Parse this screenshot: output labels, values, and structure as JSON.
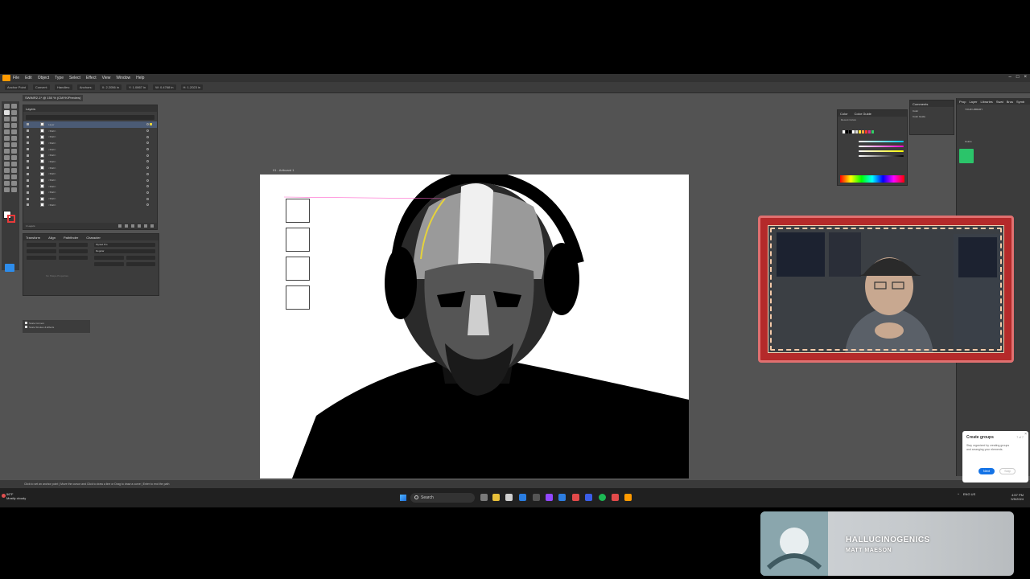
{
  "window": {
    "menus": [
      "File",
      "Edit",
      "Object",
      "Type",
      "Select",
      "Effect",
      "View",
      "Window",
      "Help"
    ],
    "doc_tab": "SWIMR2-1* @ 150 % (CMYK/Preview)",
    "control_bar": [
      "Anchor Point",
      "Convert:",
      "Handles:",
      "Anchors:",
      "X: 2.2056 in",
      "Y: 1.0867 in",
      "W: 0.4768 in",
      "H: 1.2023 in"
    ]
  },
  "layers_panel": {
    "tabs": [
      "Layers"
    ],
    "rows": [
      {
        "label": "Layer",
        "selected": true
      },
      {
        "label": "<Path>",
        "selected": false
      },
      {
        "label": "<Path>",
        "selected": false
      },
      {
        "label": "<Path>",
        "selected": false
      },
      {
        "label": "<Path>",
        "selected": false
      },
      {
        "label": "<Path>",
        "selected": false
      },
      {
        "label": "<Path>",
        "selected": false
      },
      {
        "label": "<Path>",
        "selected": false
      },
      {
        "label": "<Path>",
        "selected": false
      },
      {
        "label": "<Path>",
        "selected": false
      },
      {
        "label": "<Path>",
        "selected": false
      },
      {
        "label": "<Path>",
        "selected": false
      },
      {
        "label": "<Path>",
        "selected": false
      },
      {
        "label": "<Path>",
        "selected": false
      }
    ],
    "footer": "1 Layers"
  },
  "props_panel": {
    "tabs": [
      "Transform",
      "Align",
      "Pathfinder",
      "Character"
    ],
    "font": "Myriad Pro",
    "style": "Regular",
    "placeholder": "No Shape Properties"
  },
  "scale_options": [
    "Scale Corners",
    "Scale Strokes & Effects"
  ],
  "artboard": {
    "label": "01 - Artboard 1",
    "swatches": [
      "#ffffff",
      "#9a9a9a",
      "#3a3a3a",
      "#000000"
    ]
  },
  "color_panel": {
    "tabs": [
      "Color",
      "Color Guide"
    ],
    "recent_label": "Recent Colors",
    "recent": [
      "#ffffff",
      "#000000",
      "#000000",
      "#ffffff",
      "#d8d8d8",
      "#ffe23a",
      "#f7a23a",
      "#ff3333",
      "#cc3399",
      "#33cc66"
    ]
  },
  "comments_panel": {
    "tabs": [
      "Comments"
    ],
    "items": [
      "Color",
      "Color Guide"
    ]
  },
  "libraries_panel": {
    "tabs": [
      "Prop",
      "Layer",
      "Libraries",
      "Swat",
      "Brus",
      "Symb"
    ],
    "library": "YOUR LIBRARY",
    "section": "Colors"
  },
  "statusbar": {
    "hint": "Click to set an anchor point  |  Move the cursor and Click to draw a line or Drag to draw a curve  |  Enter to end the path"
  },
  "popup": {
    "title": "Create groups",
    "step": "7 of 7",
    "body": "Stay organized by creating groups and arranging your elements.",
    "next": "Next",
    "skip": "Skip"
  },
  "taskbar": {
    "weather_temp": "56°F",
    "weather_text": "Mostly cloudy",
    "search": "Search",
    "time": "4:57 PM",
    "date": "5/5/2024",
    "lang": "ENG US"
  },
  "music": {
    "title": "HALLUCINOGENICS",
    "artist": "MATT MAESON"
  },
  "colors": {
    "accent": "#1473e6",
    "frame": "#b42a2a",
    "library_color": "#2bc46a"
  }
}
